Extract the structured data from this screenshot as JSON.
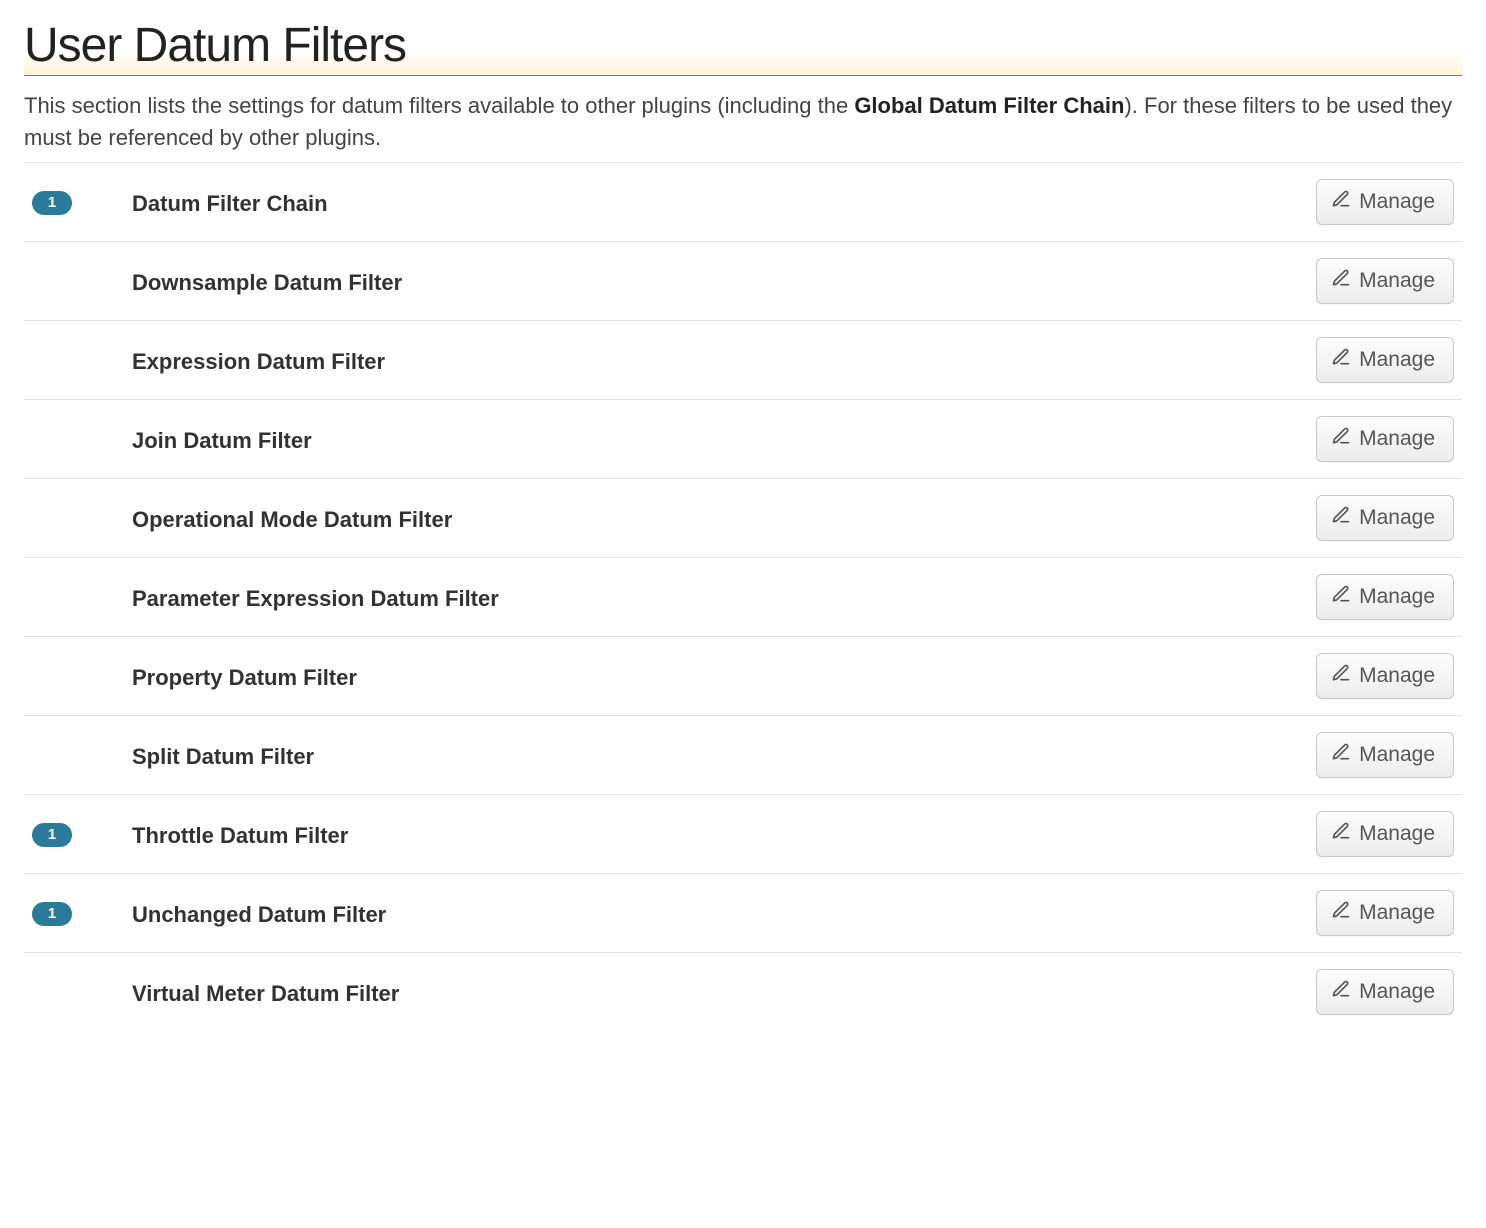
{
  "header": {
    "title": "User Datum Filters"
  },
  "description": {
    "prefix": "This section lists the settings for datum filters available to other plugins (including the ",
    "bold": "Global Datum Filter Chain",
    "suffix": "). For these filters to be used they must be referenced by other plugins."
  },
  "manage_label": "Manage",
  "filters": [
    {
      "badge": "1",
      "name": "Datum Filter Chain"
    },
    {
      "badge": "",
      "name": "Downsample Datum Filter"
    },
    {
      "badge": "",
      "name": "Expression Datum Filter"
    },
    {
      "badge": "",
      "name": "Join Datum Filter"
    },
    {
      "badge": "",
      "name": "Operational Mode Datum Filter"
    },
    {
      "badge": "",
      "name": "Parameter Expression Datum Filter"
    },
    {
      "badge": "",
      "name": "Property Datum Filter"
    },
    {
      "badge": "",
      "name": "Split Datum Filter"
    },
    {
      "badge": "1",
      "name": "Throttle Datum Filter"
    },
    {
      "badge": "1",
      "name": "Unchanged Datum Filter"
    },
    {
      "badge": "",
      "name": "Virtual Meter Datum Filter"
    }
  ]
}
